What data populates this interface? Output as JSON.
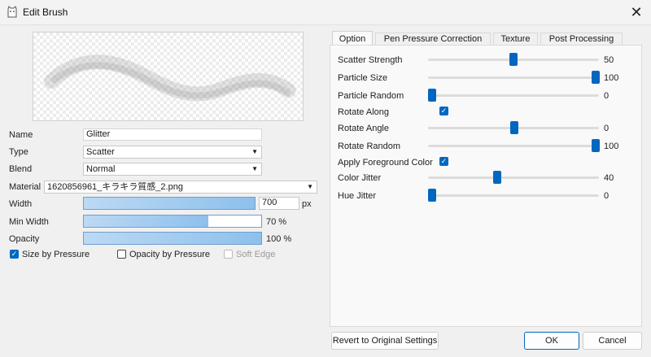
{
  "window": {
    "title": "Edit Brush",
    "close_glyph": "✕",
    "app_icon": "cat-app-icon"
  },
  "brush": {
    "name_label": "Name",
    "name_value": "Glitter",
    "type_label": "Type",
    "type_value": "Scatter",
    "blend_label": "Blend",
    "blend_value": "Normal",
    "material_label": "Material",
    "material_value": "1620856961_キラキラ質感_2.png",
    "width_label": "Width",
    "width_value": "700",
    "width_unit": "px",
    "width_fill": 1.0,
    "minwidth_label": "Min Width",
    "minwidth_value": "70 %",
    "minwidth_fill": 0.7,
    "opacity_label": "Opacity",
    "opacity_value": "100 %",
    "opacity_fill": 1.0
  },
  "checks": {
    "size_by_pressure": {
      "label": "Size by Pressure",
      "checked": true
    },
    "opacity_by_pressure": {
      "label": "Opacity by Pressure",
      "checked": false
    },
    "soft_edge": {
      "label": "Soft Edge",
      "checked": false,
      "disabled": true
    }
  },
  "tabs": [
    {
      "label": "Option",
      "active": true
    },
    {
      "label": "Pen Pressure Correction",
      "active": false
    },
    {
      "label": "Texture",
      "active": false
    },
    {
      "label": "Post Processing",
      "active": false
    }
  ],
  "options": [
    {
      "label": "Scatter Strength",
      "kind": "slider",
      "value": "50",
      "fraction": 0.5
    },
    {
      "label": "Particle Size",
      "kind": "slider",
      "value": "100",
      "fraction": 1.0
    },
    {
      "label": "Particle Random",
      "kind": "slider",
      "value": "0",
      "fraction": 0.0
    },
    {
      "label": "Rotate Along",
      "kind": "check",
      "checked": true
    },
    {
      "label": "Rotate Angle",
      "kind": "slider",
      "value": "0",
      "fraction": 0.5
    },
    {
      "label": "Rotate Random",
      "kind": "slider",
      "value": "100",
      "fraction": 1.0
    },
    {
      "label": "Apply Foreground Color",
      "kind": "check",
      "checked": true
    },
    {
      "label": "Color Jitter",
      "kind": "slider",
      "value": "40",
      "fraction": 0.4
    },
    {
      "label": "Hue Jitter",
      "kind": "slider",
      "value": "0",
      "fraction": 0.0
    }
  ],
  "buttons": {
    "revert": "Revert to Original Settings",
    "ok": "OK",
    "cancel": "Cancel"
  },
  "colors": {
    "accent": "#0067c0",
    "bar_fill": "#8dc0ec"
  }
}
